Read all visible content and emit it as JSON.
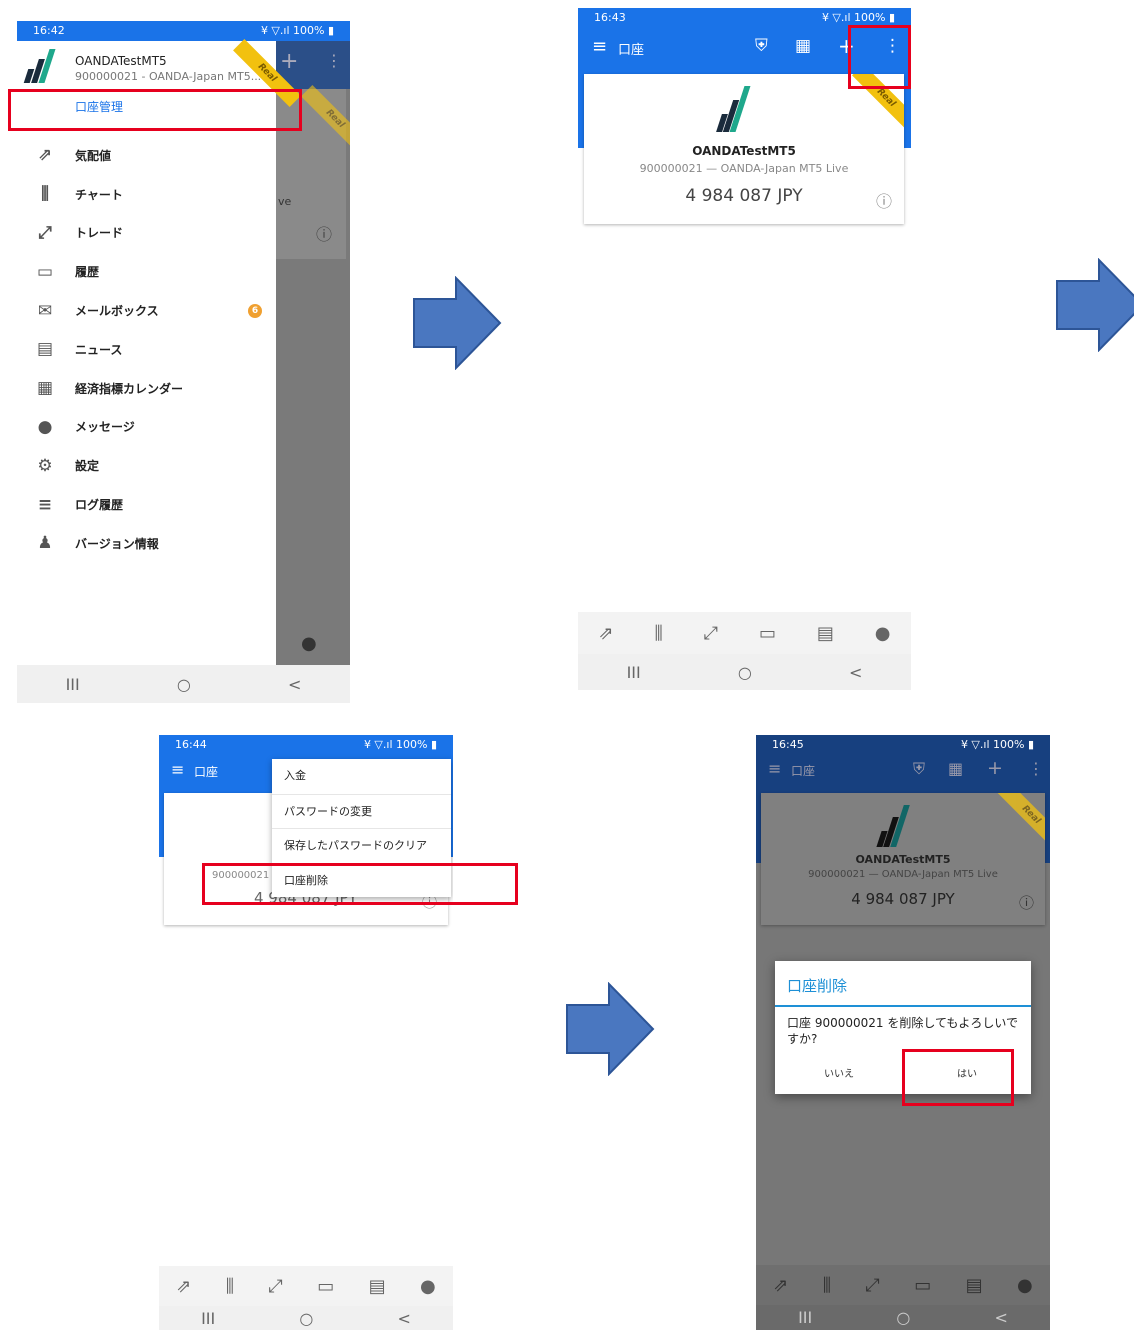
{
  "screen1": {
    "time": "16:42",
    "status_right": "¥ ▽.ıl 100% ▮",
    "account_name": "OANDATestMT5",
    "account_sub": "900000021 - OANDA-Japan MT5...",
    "ribbon": "Real",
    "manage_link": "口座管理",
    "menu": [
      {
        "label": "気配値",
        "icon": "quotes-icon",
        "glyph": "⇗"
      },
      {
        "label": "チャート",
        "icon": "chart-icon",
        "glyph": "⫼"
      },
      {
        "label": "トレード",
        "icon": "trade-icon",
        "glyph": "⤢"
      },
      {
        "label": "履歴",
        "icon": "history-icon",
        "glyph": "▭"
      },
      {
        "label": "メールボックス",
        "icon": "mail-icon",
        "glyph": "✉",
        "badge": "6"
      },
      {
        "label": "ニュース",
        "icon": "news-icon",
        "glyph": "▤"
      },
      {
        "label": "経済指標カレンダー",
        "icon": "calendar-icon",
        "glyph": "▦"
      },
      {
        "label": "メッセージ",
        "icon": "message-icon",
        "glyph": "●"
      },
      {
        "label": "設定",
        "icon": "gear-icon",
        "glyph": "⚙"
      },
      {
        "label": "ログ履歴",
        "icon": "log-icon",
        "glyph": "≡"
      },
      {
        "label": "バージョン情報",
        "icon": "version-icon",
        "glyph": "♟"
      }
    ],
    "behind_text": "ve"
  },
  "screen2": {
    "time": "16:43",
    "title": "口座",
    "account_name": "OANDATestMT5",
    "account_sub": "900000021 — OANDA-Japan MT5 Live",
    "balance": "4 984 087 JPY",
    "ribbon": "Real"
  },
  "screen3": {
    "time": "16:44",
    "title": "口座",
    "menu": [
      "入金",
      "パスワードの変更",
      "保存したパスワードのクリア",
      "口座削除"
    ],
    "account_num": "900000021",
    "balance_partial": "4 984 087 JPY"
  },
  "screen4": {
    "time": "16:45",
    "title": "口座",
    "account_name": "OANDATestMT5",
    "account_sub": "900000021 — OANDA-Japan MT5 Live",
    "balance": "4 984 087 JPY",
    "ribbon": "Real",
    "dialog_title": "口座削除",
    "dialog_message": "口座 900000021 を削除してもよろしいですか?",
    "no_label": "いいえ",
    "yes_label": "はい"
  },
  "nav": {
    "recent": "III",
    "home": "○",
    "back": "<"
  },
  "tabs": [
    "⇗",
    "⫼",
    "⤢",
    "▭",
    "▤",
    "●"
  ],
  "colors": {
    "blue": "#1a73e8",
    "red": "#e6001e",
    "arrow": "#4a77c0",
    "gold": "#f2c10f"
  }
}
